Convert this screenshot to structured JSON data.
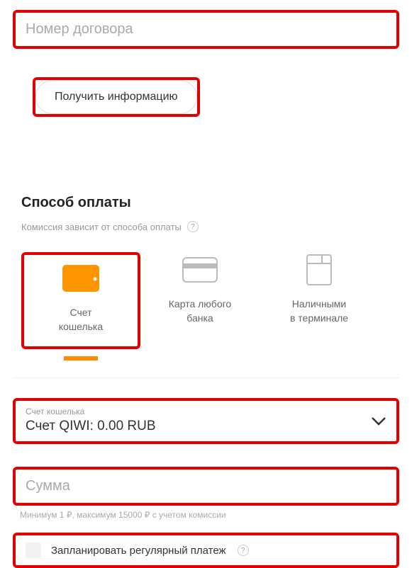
{
  "contract": {
    "placeholder": "Номер договора"
  },
  "info_button": {
    "label": "Получить информацию"
  },
  "payment_method": {
    "title": "Способ оплаты",
    "commission_note": "Комиссия зависит от способа оплаты",
    "help": "?",
    "options": {
      "wallet": {
        "line1": "Счет",
        "line2": "кошелька"
      },
      "card": {
        "line1": "Карта любого",
        "line2": "банка"
      },
      "cash": {
        "line1": "Наличными",
        "line2": "в терминале"
      }
    }
  },
  "wallet_select": {
    "floating_label": "Счет кошелька",
    "value": "Счет QIWI: 0.00 RUB"
  },
  "amount": {
    "placeholder": "Сумма",
    "hint": "Минимум 1 ₽, максимум 15000 ₽ с учетом комиссии"
  },
  "schedule": {
    "label": "Запланировать регулярный платеж",
    "help": "?"
  }
}
